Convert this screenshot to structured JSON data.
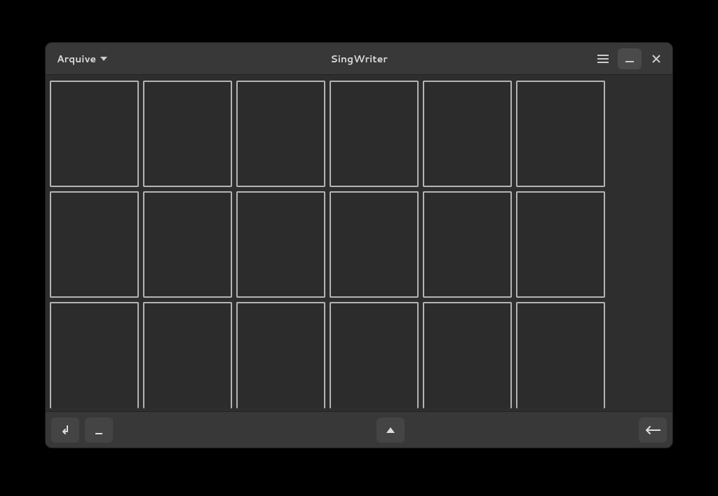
{
  "window": {
    "title": "SingWriter"
  },
  "menu": {
    "arquive_label": "Arquive"
  },
  "grid": {
    "rows": 3,
    "cols": 6,
    "cells": [
      {
        "row": 0,
        "col": 0
      },
      {
        "row": 0,
        "col": 1
      },
      {
        "row": 0,
        "col": 2
      },
      {
        "row": 0,
        "col": 3
      },
      {
        "row": 0,
        "col": 4
      },
      {
        "row": 0,
        "col": 5
      },
      {
        "row": 1,
        "col": 0
      },
      {
        "row": 1,
        "col": 1
      },
      {
        "row": 1,
        "col": 2
      },
      {
        "row": 1,
        "col": 3
      },
      {
        "row": 1,
        "col": 4
      },
      {
        "row": 1,
        "col": 5
      },
      {
        "row": 2,
        "col": 0
      },
      {
        "row": 2,
        "col": 1
      },
      {
        "row": 2,
        "col": 2
      },
      {
        "row": 2,
        "col": 3
      },
      {
        "row": 2,
        "col": 4
      },
      {
        "row": 2,
        "col": 5
      }
    ]
  }
}
